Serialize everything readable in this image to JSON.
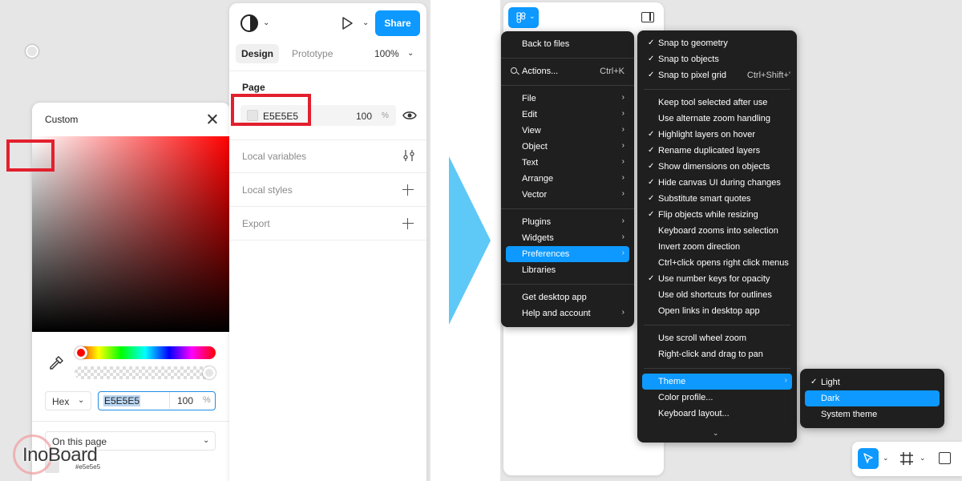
{
  "color_picker": {
    "title": "Custom",
    "format": "Hex",
    "hex": "E5E5E5",
    "alpha": "100",
    "alpha_unit": "%",
    "library": "On this page",
    "swatch_hex": "#e5e5e5",
    "hue_value": 0,
    "alpha_value": 1.0
  },
  "watermark": {
    "text": "InoBoard"
  },
  "design_panel": {
    "share_label": "Share",
    "tabs": [
      {
        "label": "Design",
        "active": true
      },
      {
        "label": "Prototype",
        "active": false
      }
    ],
    "zoom": "100%",
    "page_heading": "Page",
    "page_fill_hex": "E5E5E5",
    "page_fill_opacity": "100",
    "page_fill_unit": "%",
    "sections": [
      "Local variables",
      "Local styles",
      "Export"
    ]
  },
  "main_menu": {
    "items": [
      {
        "label": "Back to files"
      },
      {
        "label": "Actions...",
        "shortcut": "Ctrl+K"
      },
      {
        "label": "File",
        "submenu": true
      },
      {
        "label": "Edit",
        "submenu": true
      },
      {
        "label": "View",
        "submenu": true
      },
      {
        "label": "Object",
        "submenu": true
      },
      {
        "label": "Text",
        "submenu": true
      },
      {
        "label": "Arrange",
        "submenu": true
      },
      {
        "label": "Vector",
        "submenu": true
      },
      {
        "label": "Plugins",
        "submenu": true
      },
      {
        "label": "Widgets",
        "submenu": true
      },
      {
        "label": "Preferences",
        "submenu": true,
        "active": true
      },
      {
        "label": "Libraries"
      },
      {
        "label": "Get desktop app"
      },
      {
        "label": "Help and account",
        "submenu": true
      }
    ]
  },
  "preferences_menu": {
    "items": [
      {
        "label": "Snap to geometry",
        "checked": true
      },
      {
        "label": "Snap to objects",
        "checked": true
      },
      {
        "label": "Snap to pixel grid",
        "checked": true,
        "shortcut": "Ctrl+Shift+'"
      },
      {
        "label": "Keep tool selected after use",
        "checked": false
      },
      {
        "label": "Use alternate zoom handling",
        "checked": false
      },
      {
        "label": "Highlight layers on hover",
        "checked": true
      },
      {
        "label": "Rename duplicated layers",
        "checked": true
      },
      {
        "label": "Show dimensions on objects",
        "checked": true
      },
      {
        "label": "Hide canvas UI during changes",
        "checked": true
      },
      {
        "label": "Substitute smart quotes",
        "checked": true
      },
      {
        "label": "Flip objects while resizing",
        "checked": true
      },
      {
        "label": "Keyboard zooms into selection",
        "checked": false
      },
      {
        "label": "Invert zoom direction",
        "checked": false
      },
      {
        "label": "Ctrl+click opens right click menus",
        "checked": false
      },
      {
        "label": "Use number keys for opacity",
        "checked": true
      },
      {
        "label": "Use old shortcuts for outlines",
        "checked": false
      },
      {
        "label": "Open links in desktop app",
        "checked": false
      },
      {
        "label": "Use scroll wheel zoom",
        "checked": false
      },
      {
        "label": "Right-click and drag to pan",
        "checked": false
      },
      {
        "label": "Theme",
        "submenu": true,
        "active": true
      },
      {
        "label": "Color profile...",
        "checked": false
      },
      {
        "label": "Keyboard layout...",
        "checked": false
      }
    ],
    "more_indicator": "⌄"
  },
  "theme_menu": {
    "items": [
      {
        "label": "Light",
        "checked": true
      },
      {
        "label": "Dark",
        "checked": false,
        "active": true
      },
      {
        "label": "System theme",
        "checked": false
      }
    ]
  },
  "colors": {
    "accent": "#0d99ff",
    "menu_bg": "#1f1f1f",
    "highlight_red": "#e2202e",
    "arrow": "#5ec8f7"
  }
}
